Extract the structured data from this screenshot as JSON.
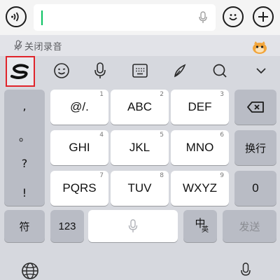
{
  "input_bar": {
    "voice_button_icon": "voice-input-icon",
    "text_value": "",
    "emoji_button_icon": "emoji-icon",
    "plus_button_icon": "plus-icon",
    "caret_color": "#07c160"
  },
  "voice_status": {
    "label": "关闭录音",
    "icon": "mic-off-icon"
  },
  "toolbar": {
    "items": [
      {
        "name": "sogou-logo-button",
        "icon": "sogou-s-icon"
      },
      {
        "name": "emoji-toolbar-button",
        "icon": "smile-icon"
      },
      {
        "name": "voice-toolbar-button",
        "icon": "microphone-icon"
      },
      {
        "name": "keyboard-toolbar-button",
        "icon": "keyboard-icon"
      },
      {
        "name": "handwriting-toolbar-button",
        "icon": "pen-icon"
      },
      {
        "name": "search-toolbar-button",
        "icon": "search-icon"
      },
      {
        "name": "collapse-toolbar-button",
        "icon": "chevron-down-icon"
      }
    ],
    "highlight_color": "#e0242b"
  },
  "keyboard": {
    "punctuation": [
      ",",
      "。",
      "?",
      "!"
    ],
    "keys": [
      {
        "label": "@/.",
        "num": "1"
      },
      {
        "label": "ABC",
        "num": "2"
      },
      {
        "label": "DEF",
        "num": "3"
      },
      {
        "label": "GHI",
        "num": "4"
      },
      {
        "label": "JKL",
        "num": "5"
      },
      {
        "label": "MNO",
        "num": "6"
      },
      {
        "label": "PQRS",
        "num": "7"
      },
      {
        "label": "TUV",
        "num": "8"
      },
      {
        "label": "WXYZ",
        "num": "9"
      }
    ],
    "right_keys": {
      "delete_icon": "backspace-icon",
      "newline": "换行",
      "zero": "0",
      "send": "发送"
    },
    "bottom": {
      "symbols": "符",
      "numbers": "123",
      "space_icon": "microphone-icon",
      "lang_main": "中",
      "lang_sub": "英"
    },
    "globe_icon": "globe-icon"
  }
}
